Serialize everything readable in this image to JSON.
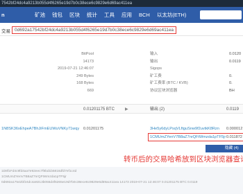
{
  "topbar": {
    "text": "7542bf24dc4a9213b055d4f6265e19d7b0c38ece6c9829e6d69ac411ea"
  },
  "nav": {
    "logo": "n",
    "items": [
      "矿池",
      "钱包",
      "区块",
      "统计",
      "工具",
      "应用",
      "BCH",
      "以太坊(ETH)"
    ]
  },
  "tx": {
    "label": "交易",
    "hash": "0d692a17542bf24dc4a9213b055d4f6265e19d7b0c38ece6c9829e6d69ac411ea"
  },
  "info": {
    "left_values": [
      "BitPool",
      "14173",
      "2019-07-21 12:46:07",
      "249 Bytes",
      "168 Bytes",
      "669"
    ],
    "right_labels": [
      "输入",
      "输出",
      "Sigops",
      "矿工费",
      "矿工费率 (BTC / KVB)",
      "协议区块浏览器"
    ],
    "right_values": [
      "0.0120",
      "0.0119",
      "",
      "0.",
      "0.",
      "BH"
    ]
  },
  "summary": {
    "input_total": "0.01201175 BTC",
    "arrow": "▶",
    "output_label": "输出 (2)",
    "output_total": "0.0119"
  },
  "inputs": [
    {
      "address": "1N8SK36xEhpeA7BhJiFmEUWuVNKy71wqy",
      "value": "0.01201175"
    }
  ],
  "outputs": [
    {
      "address": "3He5y6dyLPsqVLftguSnw9f2uvtkK8Rzn",
      "value": "0.000012"
    },
    {
      "address": "1CMUmZYenV7B8aZ7nrQFtWmzda1pTF5jr",
      "value": "0.011872"
    }
  ],
  "button": {
    "label": "隐藏 (4)"
  },
  "annotation": {
    "text": "转币后的交易哈希放到区块浏览器查询"
  },
  "footer": {
    "lines": [
      "1D8f1Fd4c9fd4aa7e92eec7f8bd1b5816dfd7ef1c4d",
      "1CMUmZYenV7B8aZ7nrQFtWmzda1pTF5jr",
      "0d692a17542bf24dc4a9213b055d4f6265e19d7b0c38ece6c9829e6d69ac411ea 14173 2019-07-21 12:46:07 0.01201175 BTC 0.0119"
    ]
  }
}
